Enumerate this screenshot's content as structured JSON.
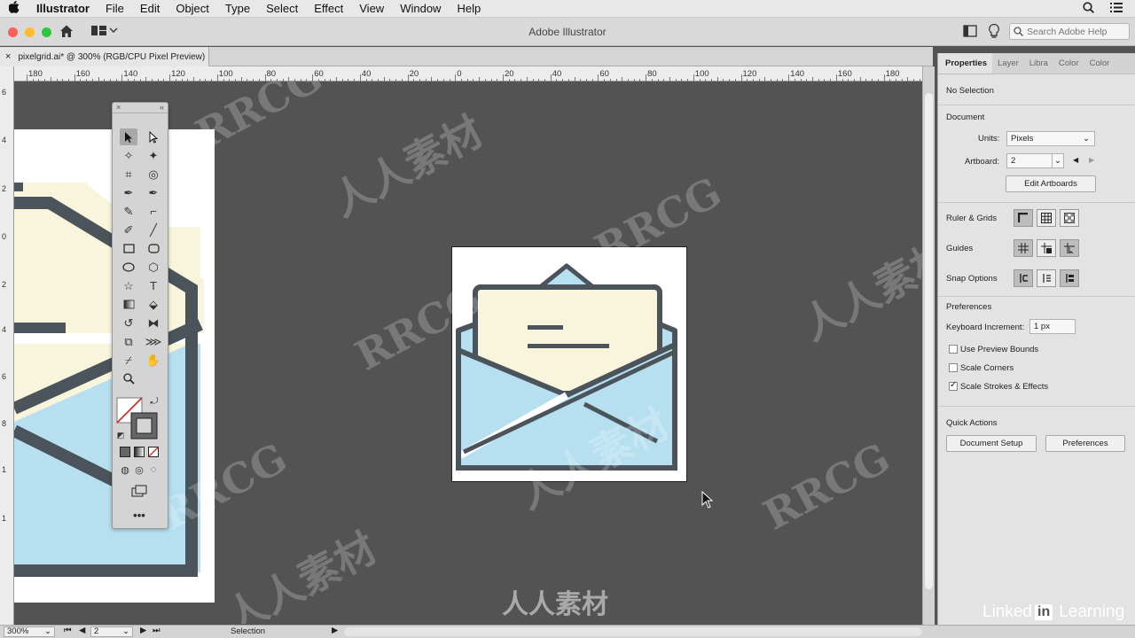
{
  "menubar": {
    "app_name": "Illustrator",
    "items": [
      "File",
      "Edit",
      "Object",
      "Type",
      "Select",
      "Effect",
      "View",
      "Window",
      "Help"
    ]
  },
  "appbar": {
    "title": "Adobe Illustrator",
    "search_placeholder": "Search Adobe Help"
  },
  "document": {
    "tab_label": "pixelgrid.ai* @ 300% (RGB/CPU Pixel Preview)"
  },
  "ruler": {
    "h_labels": [
      "180",
      "160",
      "140",
      "120",
      "100",
      "80",
      "60",
      "40",
      "20",
      "0",
      "20",
      "40",
      "60",
      "80",
      "100",
      "120",
      "140",
      "160",
      "180"
    ],
    "v_labels": [
      "6",
      "4",
      "2",
      "0",
      "2",
      "4",
      "6",
      "8",
      "1",
      "1"
    ]
  },
  "properties": {
    "tabs": [
      "Properties",
      "Layer",
      "Libra",
      "Color",
      "Color"
    ],
    "selection_state": "No Selection",
    "document_heading": "Document",
    "units_label": "Units:",
    "units_value": "Pixels",
    "artboard_label": "Artboard:",
    "artboard_value": "2",
    "edit_artboards": "Edit Artboards",
    "ruler_grids": "Ruler & Grids",
    "guides": "Guides",
    "snap_options": "Snap Options",
    "preferences_heading": "Preferences",
    "keyboard_increment_label": "Keyboard Increment:",
    "keyboard_increment_value": "1 px",
    "use_preview_bounds": "Use Preview Bounds",
    "scale_corners": "Scale Corners",
    "scale_strokes": "Scale Strokes & Effects",
    "use_preview_bounds_checked": false,
    "scale_corners_checked": false,
    "scale_strokes_checked": true,
    "quick_actions": "Quick Actions",
    "document_setup": "Document Setup",
    "preferences_button": "Preferences"
  },
  "statusbar": {
    "zoom": "300%",
    "artboard": "2",
    "tool": "Selection"
  },
  "branding": {
    "linkedin_a": "Linked",
    "linkedin_in": "in",
    "linkedin_b": "Learning",
    "watermark_latin": "RRCG",
    "watermark_cjk": "人人素材"
  },
  "colors": {
    "canvas": "#535353",
    "stroke": "#4a545a",
    "letter": "#f8f5dc",
    "envelope": "#b6dff0"
  }
}
